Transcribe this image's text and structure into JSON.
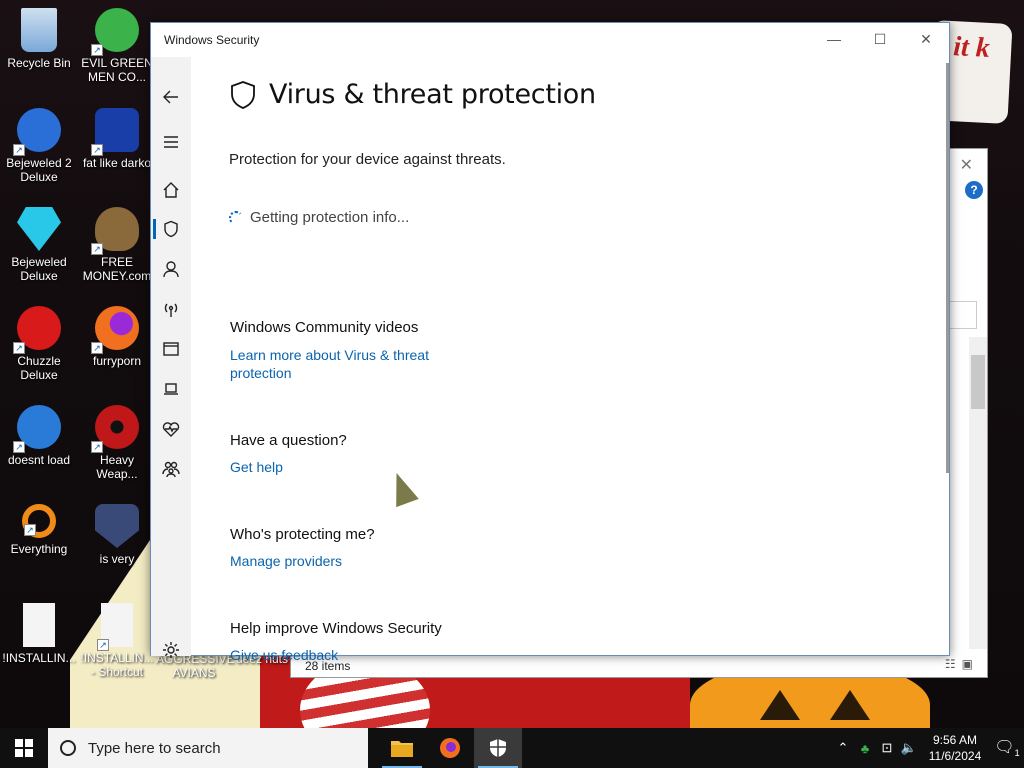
{
  "desktop": {
    "icons": [
      {
        "label": "Recycle Bin",
        "color": "#7aa8d8"
      },
      {
        "label": "EVIL GREEN MEN CO...",
        "color": "#3bb34a"
      },
      {
        "label": "Bejeweled 2 Deluxe",
        "color": "#2a6ed8"
      },
      {
        "label": "fat like darko",
        "color": "#1a3ea8"
      },
      {
        "label": "Bejeweled Deluxe",
        "color": "#2ac8e8"
      },
      {
        "label": "FREE MONEY.com",
        "color": "#8a6a3a"
      },
      {
        "label": "Chuzzle Deluxe",
        "color": "#d81a1a"
      },
      {
        "label": "furryporn",
        "color": "#f07020"
      },
      {
        "label": "doesnt load",
        "color": "#2a7ad8"
      },
      {
        "label": "Heavy Weap...",
        "color": "#c01818"
      },
      {
        "label": "Everything",
        "color": "#f08a18"
      },
      {
        "label": "is very",
        "color": "#3a4a78"
      },
      {
        "label": "!INSTALLIN...",
        "color": "#f4f4f4"
      },
      {
        "label": "!INSTALLIN... - Shortcut",
        "color": "#f4f4f4"
      },
      {
        "label": "AGGRESSIVE AVIANS",
        "color": "#000000"
      },
      {
        "label": "deez nuts",
        "color": "#000000"
      }
    ],
    "sign_text": "it k"
  },
  "explorer": {
    "status": "28 items"
  },
  "window": {
    "title": "Windows Security",
    "controls": {
      "minimize": "—",
      "maximize": "☐",
      "close": "✕"
    },
    "page_title": "Virus & threat protection",
    "subtitle": "Protection for your device against threats.",
    "loading_text": "Getting protection info...",
    "sections": [
      {
        "heading": "Windows Community videos",
        "link": "Learn more about Virus & threat protection"
      },
      {
        "heading": "Have a question?",
        "link": "Get help"
      },
      {
        "heading": "Who's protecting me?",
        "link": "Manage providers"
      },
      {
        "heading": "Help improve Windows Security",
        "link": "Give us feedback"
      }
    ],
    "nav": [
      "back",
      "menu",
      "home",
      "virus-protection",
      "account",
      "firewall",
      "app-browser",
      "device-security",
      "device-health",
      "family",
      "settings"
    ]
  },
  "taskbar": {
    "search_placeholder": "Type here to search",
    "time": "9:56 AM",
    "date": "11/6/2024",
    "notification_count": "1",
    "accent": "#76b9ed"
  }
}
